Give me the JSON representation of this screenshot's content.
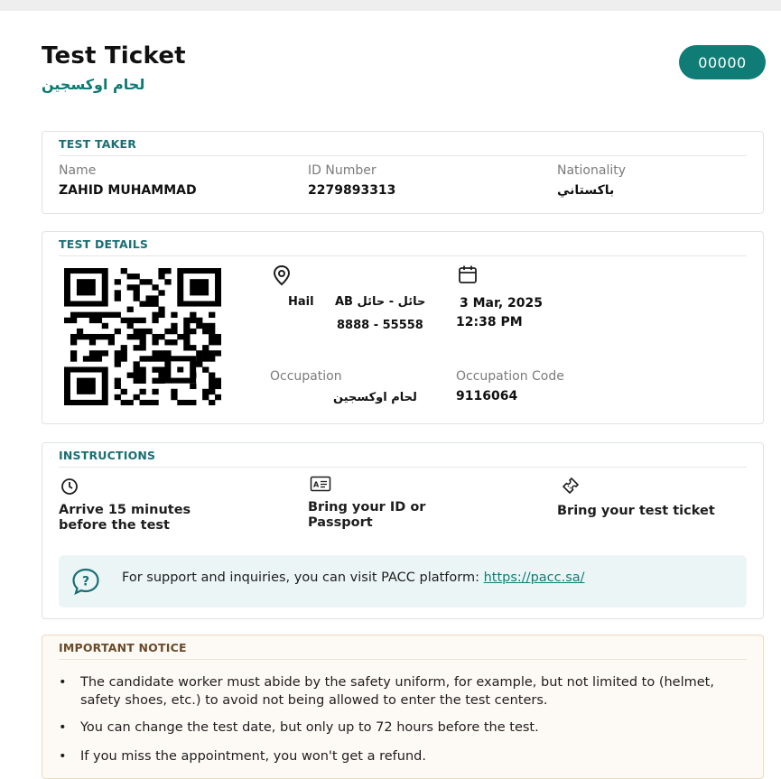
{
  "header": {
    "title": "Test Ticket",
    "subtitle": "لحام اوكسجين",
    "ticket_number": "00000"
  },
  "test_taker": {
    "section_title": "TEST TAKER",
    "name_label": "Name",
    "name_value": "ZAHID MUHAMMAD",
    "id_label": "ID Number",
    "id_value": "2279893313",
    "nationality_label": "Nationality",
    "nationality_value": "باكستاني"
  },
  "test_details": {
    "section_title": "TEST DETAILS",
    "location_city": "Hail",
    "location_center": "AB حائل - حائل",
    "location_phone": "8888 - 55558",
    "date": "3 Mar, 2025",
    "time": "12:38 PM",
    "occupation_label": "Occupation",
    "occupation_value": "لحام اوكسجين",
    "occupation_code_label": "Occupation Code",
    "occupation_code_value": "9116064"
  },
  "instructions": {
    "section_title": "INSTRUCTIONS",
    "items": [
      {
        "icon": "clock-icon",
        "line1": "Arrive 15 minutes",
        "line2": "before the test"
      },
      {
        "icon": "id-card-icon",
        "line1": "Bring your ID or",
        "line2": "Passport"
      },
      {
        "icon": "ticket-icon",
        "line1": "Bring your test ticket",
        "line2": ""
      }
    ],
    "support_text": "For support and inquiries, you can visit PACC platform: ",
    "support_link": "https://pacc.sa/"
  },
  "notice": {
    "section_title": "IMPORTANT NOTICE",
    "bullets": [
      "The candidate worker must abide by the safety uniform, for example, but not limited to (helmet, safety shoes, etc.) to avoid not being allowed to enter the test centers.",
      "You can change the test date, but only up to 72 hours before the test.",
      "If you miss the appointment, you won't get a refund."
    ]
  },
  "colors": {
    "accent": "#0f7d76",
    "section_title": "#1a6f74",
    "notice_title": "#6a4a2a",
    "support_bg": "#ecf5f5"
  }
}
